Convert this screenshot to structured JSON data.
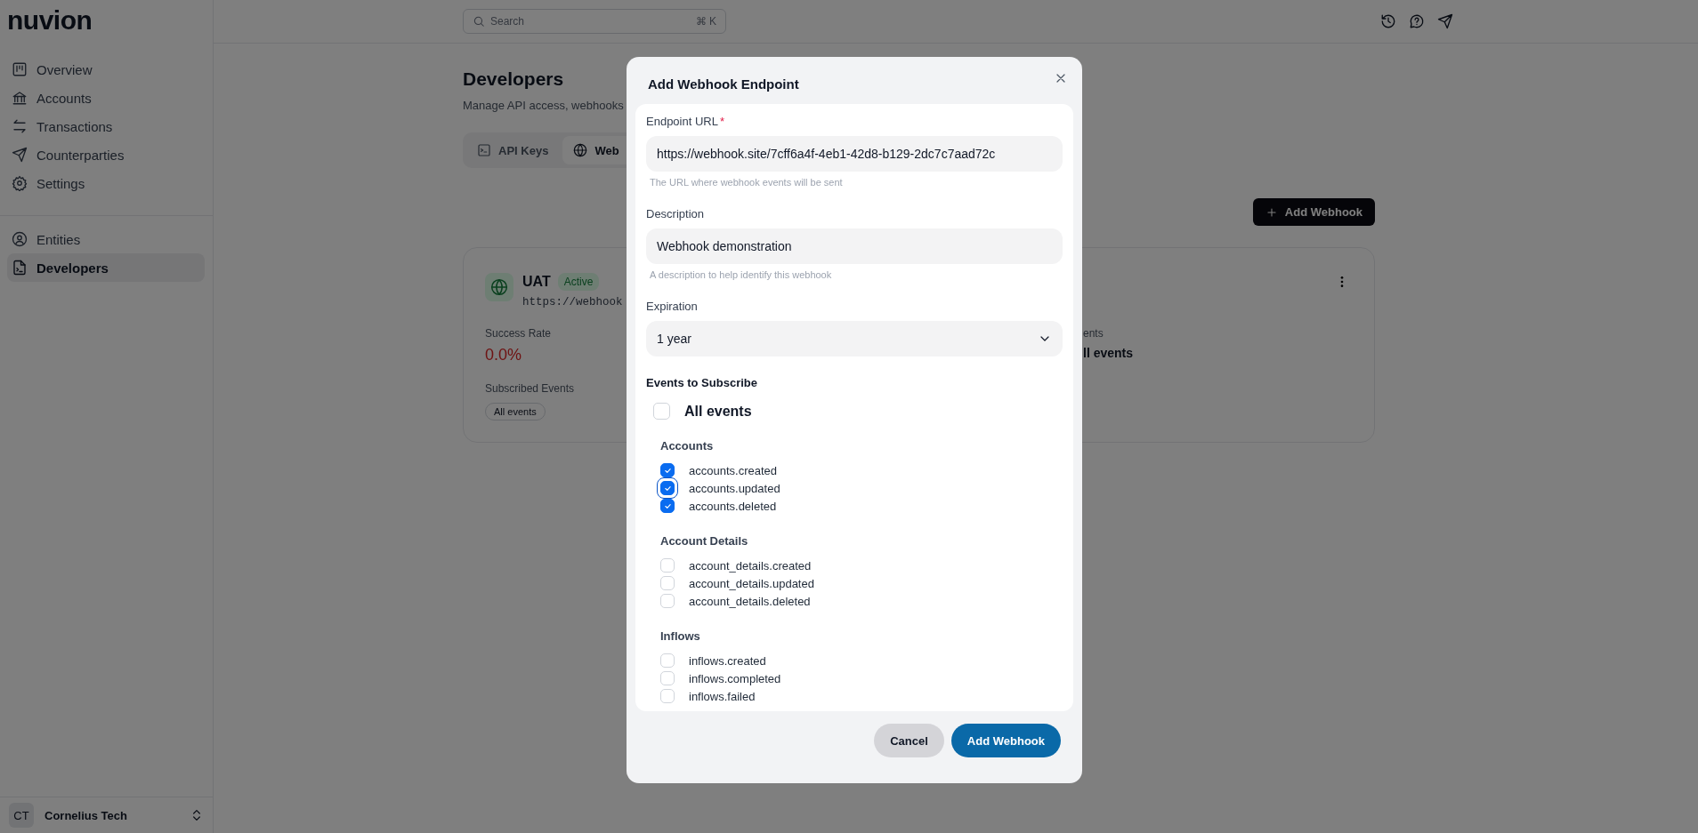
{
  "sidebar": {
    "logo": "nuvion",
    "groups": [
      [
        {
          "label": "Overview",
          "selected": false
        },
        {
          "label": "Accounts",
          "selected": false
        },
        {
          "label": "Transactions",
          "selected": false
        },
        {
          "label": "Counterparties",
          "selected": false
        },
        {
          "label": "Settings",
          "selected": false
        }
      ],
      [
        {
          "label": "Entities",
          "selected": false
        },
        {
          "label": "Developers",
          "selected": true
        }
      ]
    ],
    "workspace": {
      "initials": "CT",
      "name": "Cornelius Tech"
    }
  },
  "header": {
    "search": {
      "placeholder": "Search",
      "shortcut": "⌘ K"
    }
  },
  "page": {
    "title": "Developers",
    "subtitle": "Manage API access, webhooks",
    "tabs": [
      {
        "label": "API Keys",
        "selected": false
      },
      {
        "label": "Web",
        "selected": true
      }
    ],
    "add_button": "Add Webhook",
    "webhook_card": {
      "name": "UAT",
      "status": "Active",
      "url": "https://webhook",
      "stats": [
        {
          "label": "Success Rate",
          "value": "0.0%"
        },
        {
          "label": "ents",
          "value": "ll events"
        }
      ],
      "subscribed_label": "Subscribed Events",
      "subscribed_events": [
        "All events"
      ]
    }
  },
  "dialog": {
    "title": "Add Webhook Endpoint",
    "fields": [
      {
        "kind": "input",
        "label": "Endpoint URL",
        "required_mark": "*",
        "value": "https://webhook.site/7cff6a4f-4eb1-42d8-b129-2dc7c7aad72c",
        "help": "The URL where webhook events will be sent"
      },
      {
        "kind": "input",
        "label": "Description",
        "value": "Webhook demonstration",
        "help": "A description to help identify this webhook"
      },
      {
        "kind": "select",
        "label": "Expiration",
        "value": "1 year"
      }
    ],
    "events_title": "Events to Subscribe",
    "all_events": {
      "label": "All events",
      "checked": false
    },
    "groups": [
      {
        "title": "Accounts",
        "events": [
          {
            "label": "accounts.created",
            "checked": true,
            "focused": false
          },
          {
            "label": "accounts.updated",
            "checked": true,
            "focused": true
          },
          {
            "label": "accounts.deleted",
            "checked": true,
            "focused": false
          }
        ]
      },
      {
        "title": "Account Details",
        "events": [
          {
            "label": "account_details.created",
            "checked": false,
            "focused": false
          },
          {
            "label": "account_details.updated",
            "checked": false,
            "focused": false
          },
          {
            "label": "account_details.deleted",
            "checked": false,
            "focused": false
          }
        ]
      },
      {
        "title": "Inflows",
        "events": [
          {
            "label": "inflows.created",
            "checked": false,
            "focused": false
          },
          {
            "label": "inflows.completed",
            "checked": false,
            "focused": false
          },
          {
            "label": "inflows.failed",
            "checked": false,
            "focused": false
          }
        ]
      }
    ],
    "buttons": [
      {
        "label": "Cancel",
        "kind": "secondary"
      },
      {
        "label": "Add Webhook",
        "kind": "primary"
      }
    ]
  }
}
